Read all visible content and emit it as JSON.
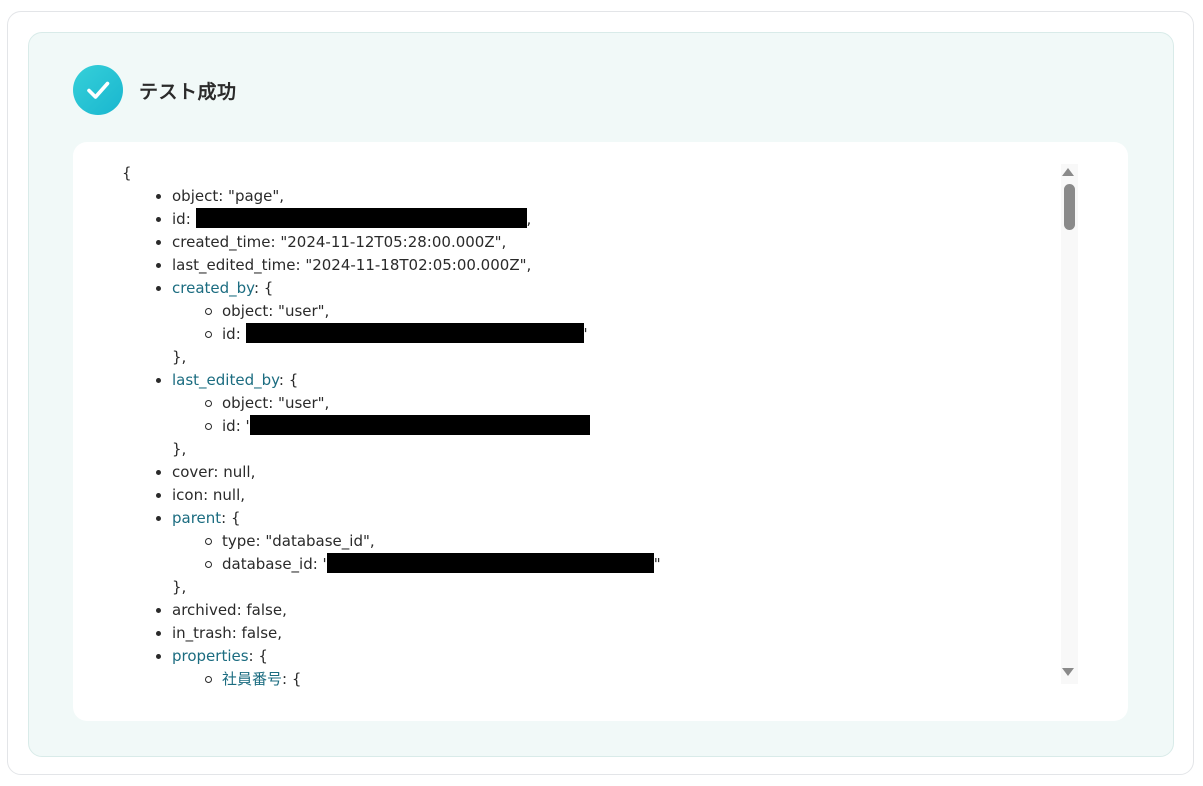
{
  "status": {
    "title": "テスト成功",
    "icon": "checkmark-circle-icon",
    "accent_color": "#1fbfd4"
  },
  "json_view": {
    "open_brace": "{",
    "lines": {
      "object": "object: \"page\",",
      "id_key": "id: ",
      "id_tail": ",",
      "created_time": "created_time: \"2024-11-12T05:28:00.000Z\",",
      "last_edited_time": "last_edited_time: \"2024-11-18T02:05:00.000Z\",",
      "created_by_key": "created_by",
      "created_by_open": ": {",
      "created_by_object": "object: \"user\",",
      "created_by_id_key": "id: ",
      "created_by_id_tail": "'",
      "created_by_close": "},",
      "last_edited_by_key": "last_edited_by",
      "last_edited_by_open": ": {",
      "last_edited_by_object": "object: \"user\",",
      "last_edited_by_id_key": "id: '",
      "last_edited_by_close": "},",
      "cover": "cover: null,",
      "icon": "icon: null,",
      "parent_key": "parent",
      "parent_open": ": {",
      "parent_type": "type: \"database_id\",",
      "parent_db_key": "database_id: '",
      "parent_db_tail": "\"",
      "parent_close": "},",
      "archived": "archived: false,",
      "in_trash": "in_trash: false,",
      "properties_key": "properties",
      "properties_open": ": {",
      "prop_first_key": "社員番号",
      "prop_first_open": ": {"
    }
  }
}
